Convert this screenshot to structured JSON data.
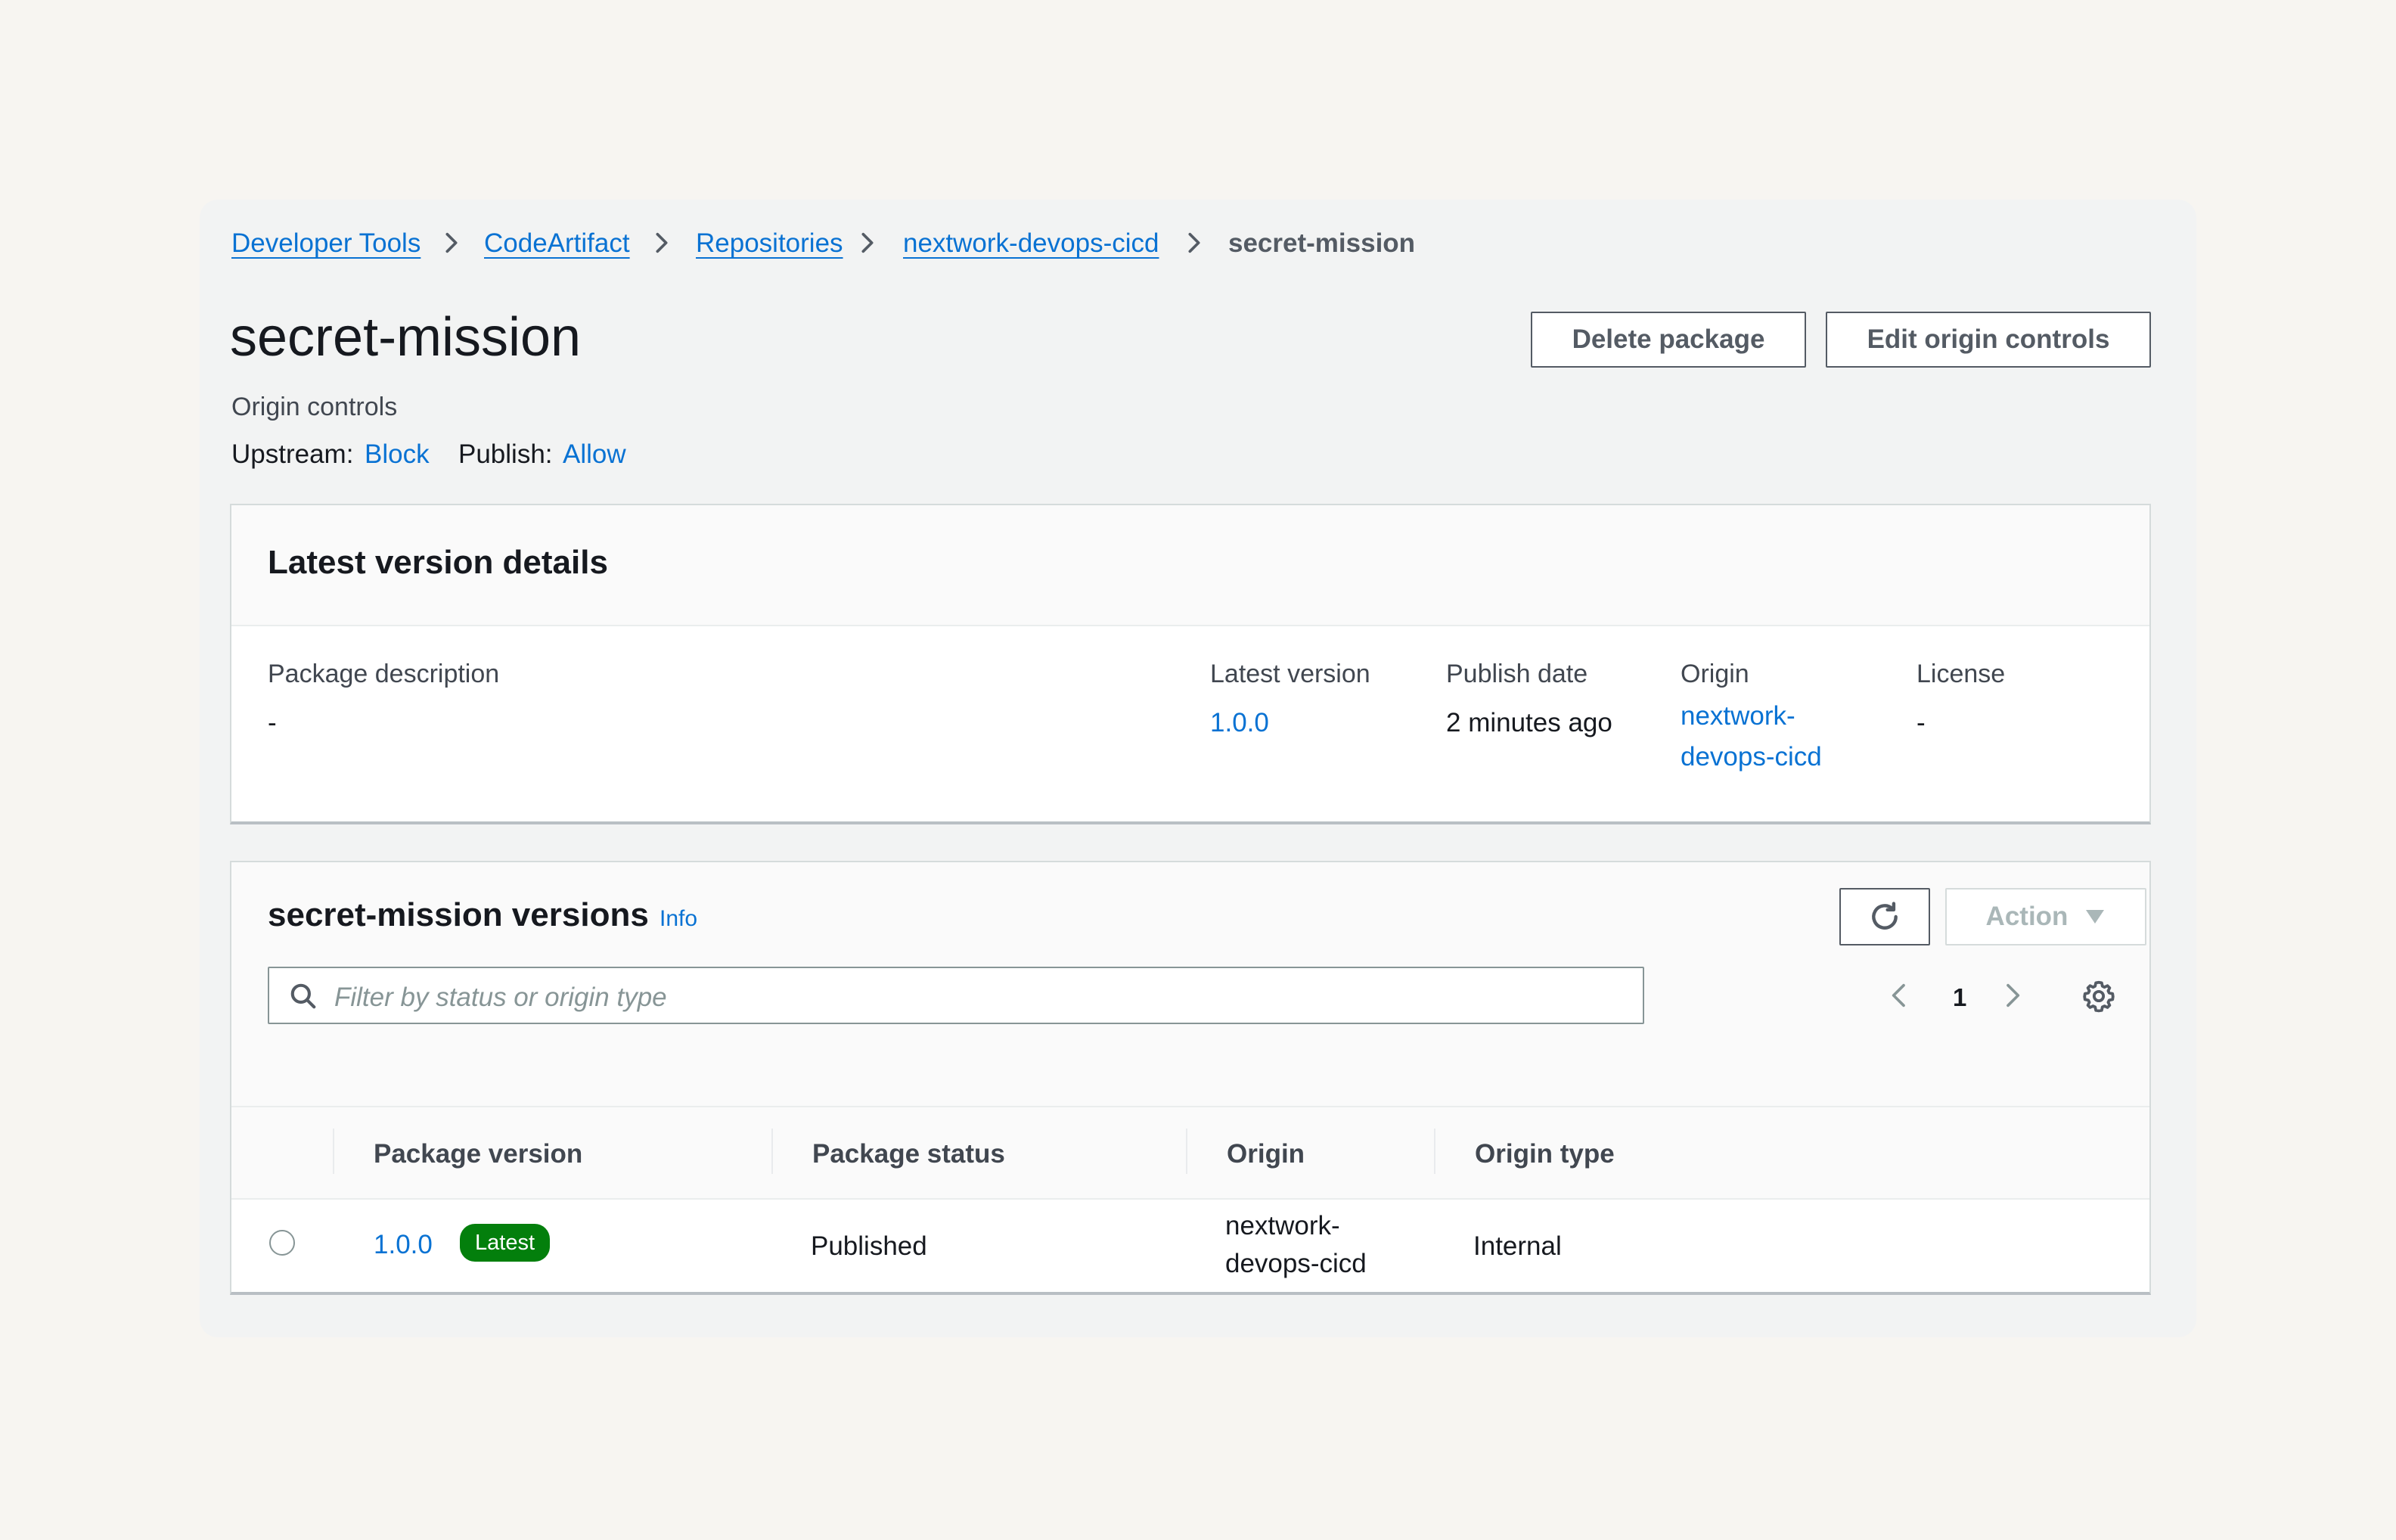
{
  "breadcrumb": {
    "items": [
      "Developer Tools",
      "CodeArtifact",
      "Repositories",
      "nextwork-devops-cicd"
    ],
    "current": "secret-mission"
  },
  "header": {
    "title": "secret-mission",
    "delete_label": "Delete package",
    "edit_label": "Edit origin controls",
    "origin_controls_label": "Origin controls",
    "upstream_label": "Upstream:",
    "upstream_value": "Block",
    "publish_label": "Publish:",
    "publish_value": "Allow"
  },
  "details": {
    "title": "Latest version details",
    "description_label": "Package description",
    "description_value": "-",
    "latest_version_label": "Latest version",
    "latest_version_value": "1.0.0",
    "publish_date_label": "Publish date",
    "publish_date_value": "2 minutes ago",
    "origin_label": "Origin",
    "origin_value": "nextwork-devops-cicd",
    "license_label": "License",
    "license_value": "-"
  },
  "versions": {
    "title": "secret-mission versions",
    "info_label": "Info",
    "action_label": "Action",
    "search_placeholder": "Filter by status or origin type",
    "page_number": "1",
    "columns": [
      "Package version",
      "Package status",
      "Origin",
      "Origin type"
    ],
    "rows": [
      {
        "version": "1.0.0",
        "badge": "Latest",
        "status": "Published",
        "origin": "nextwork-devops-cicd",
        "origin_type": "Internal"
      }
    ]
  },
  "colors": {
    "link": "#0972d3",
    "badge": "#037f0c",
    "text": "#16191f"
  },
  "icons": [
    "chevron-right-icon",
    "search-icon",
    "refresh-icon",
    "caret-down-icon",
    "chevron-left-icon",
    "gear-icon"
  ]
}
